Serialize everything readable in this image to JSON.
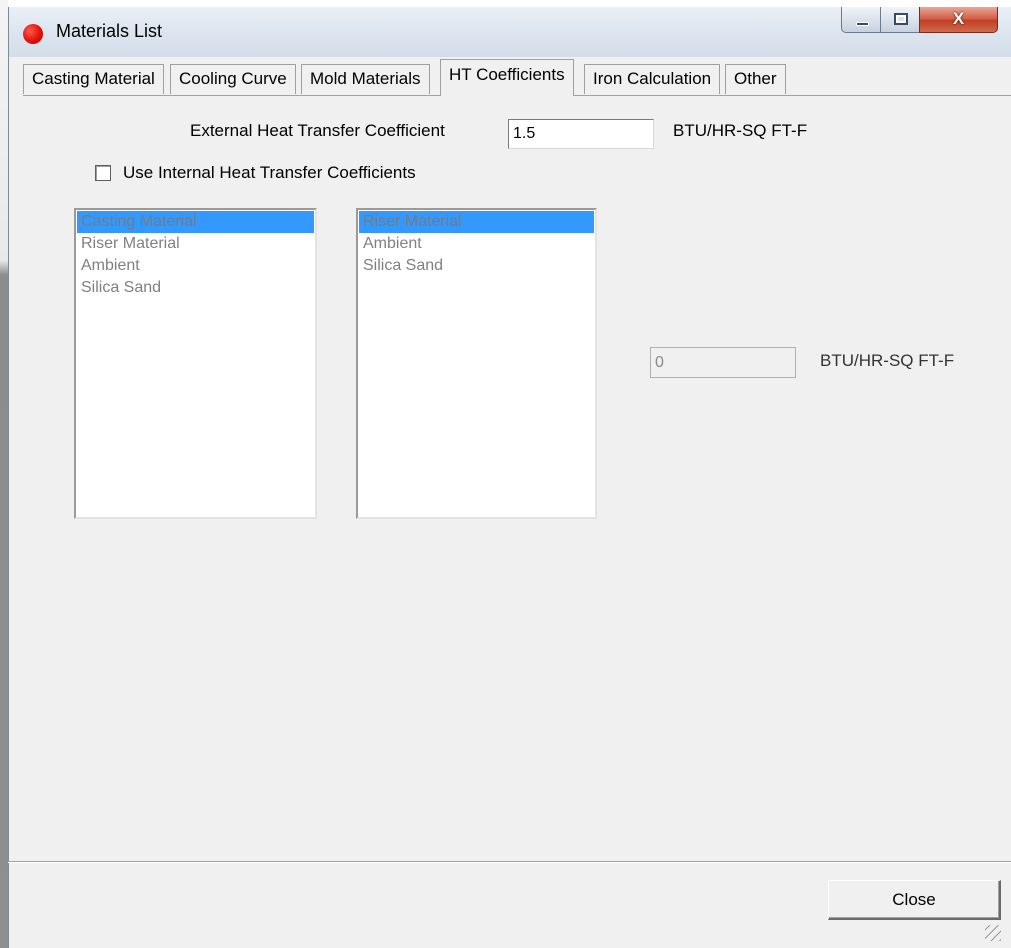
{
  "window": {
    "title": "Materials List",
    "close_glyph": "X"
  },
  "tabs": [
    {
      "label": "Casting Material"
    },
    {
      "label": "Cooling Curve"
    },
    {
      "label": "Mold Materials"
    },
    {
      "label": "HT Coefficients",
      "active": true
    },
    {
      "label": "Iron Calculation"
    },
    {
      "label": "Other"
    }
  ],
  "external": {
    "label": "External Heat Transfer Coefficient",
    "value": "1.5",
    "unit": "BTU/HR-SQ FT-F"
  },
  "internal": {
    "checkbox_label": "Use Internal Heat Transfer Coefficients",
    "checked": false,
    "left_list": [
      "Casting Material",
      "Riser Material",
      "Ambient",
      "Silica Sand"
    ],
    "left_selected": 0,
    "right_list": [
      "Riser Material",
      "Ambient",
      "Silica Sand"
    ],
    "right_selected": 0,
    "value": "0",
    "unit": "BTU/HR-SQ FT-F"
  },
  "footer": {
    "close_label": "Close"
  }
}
